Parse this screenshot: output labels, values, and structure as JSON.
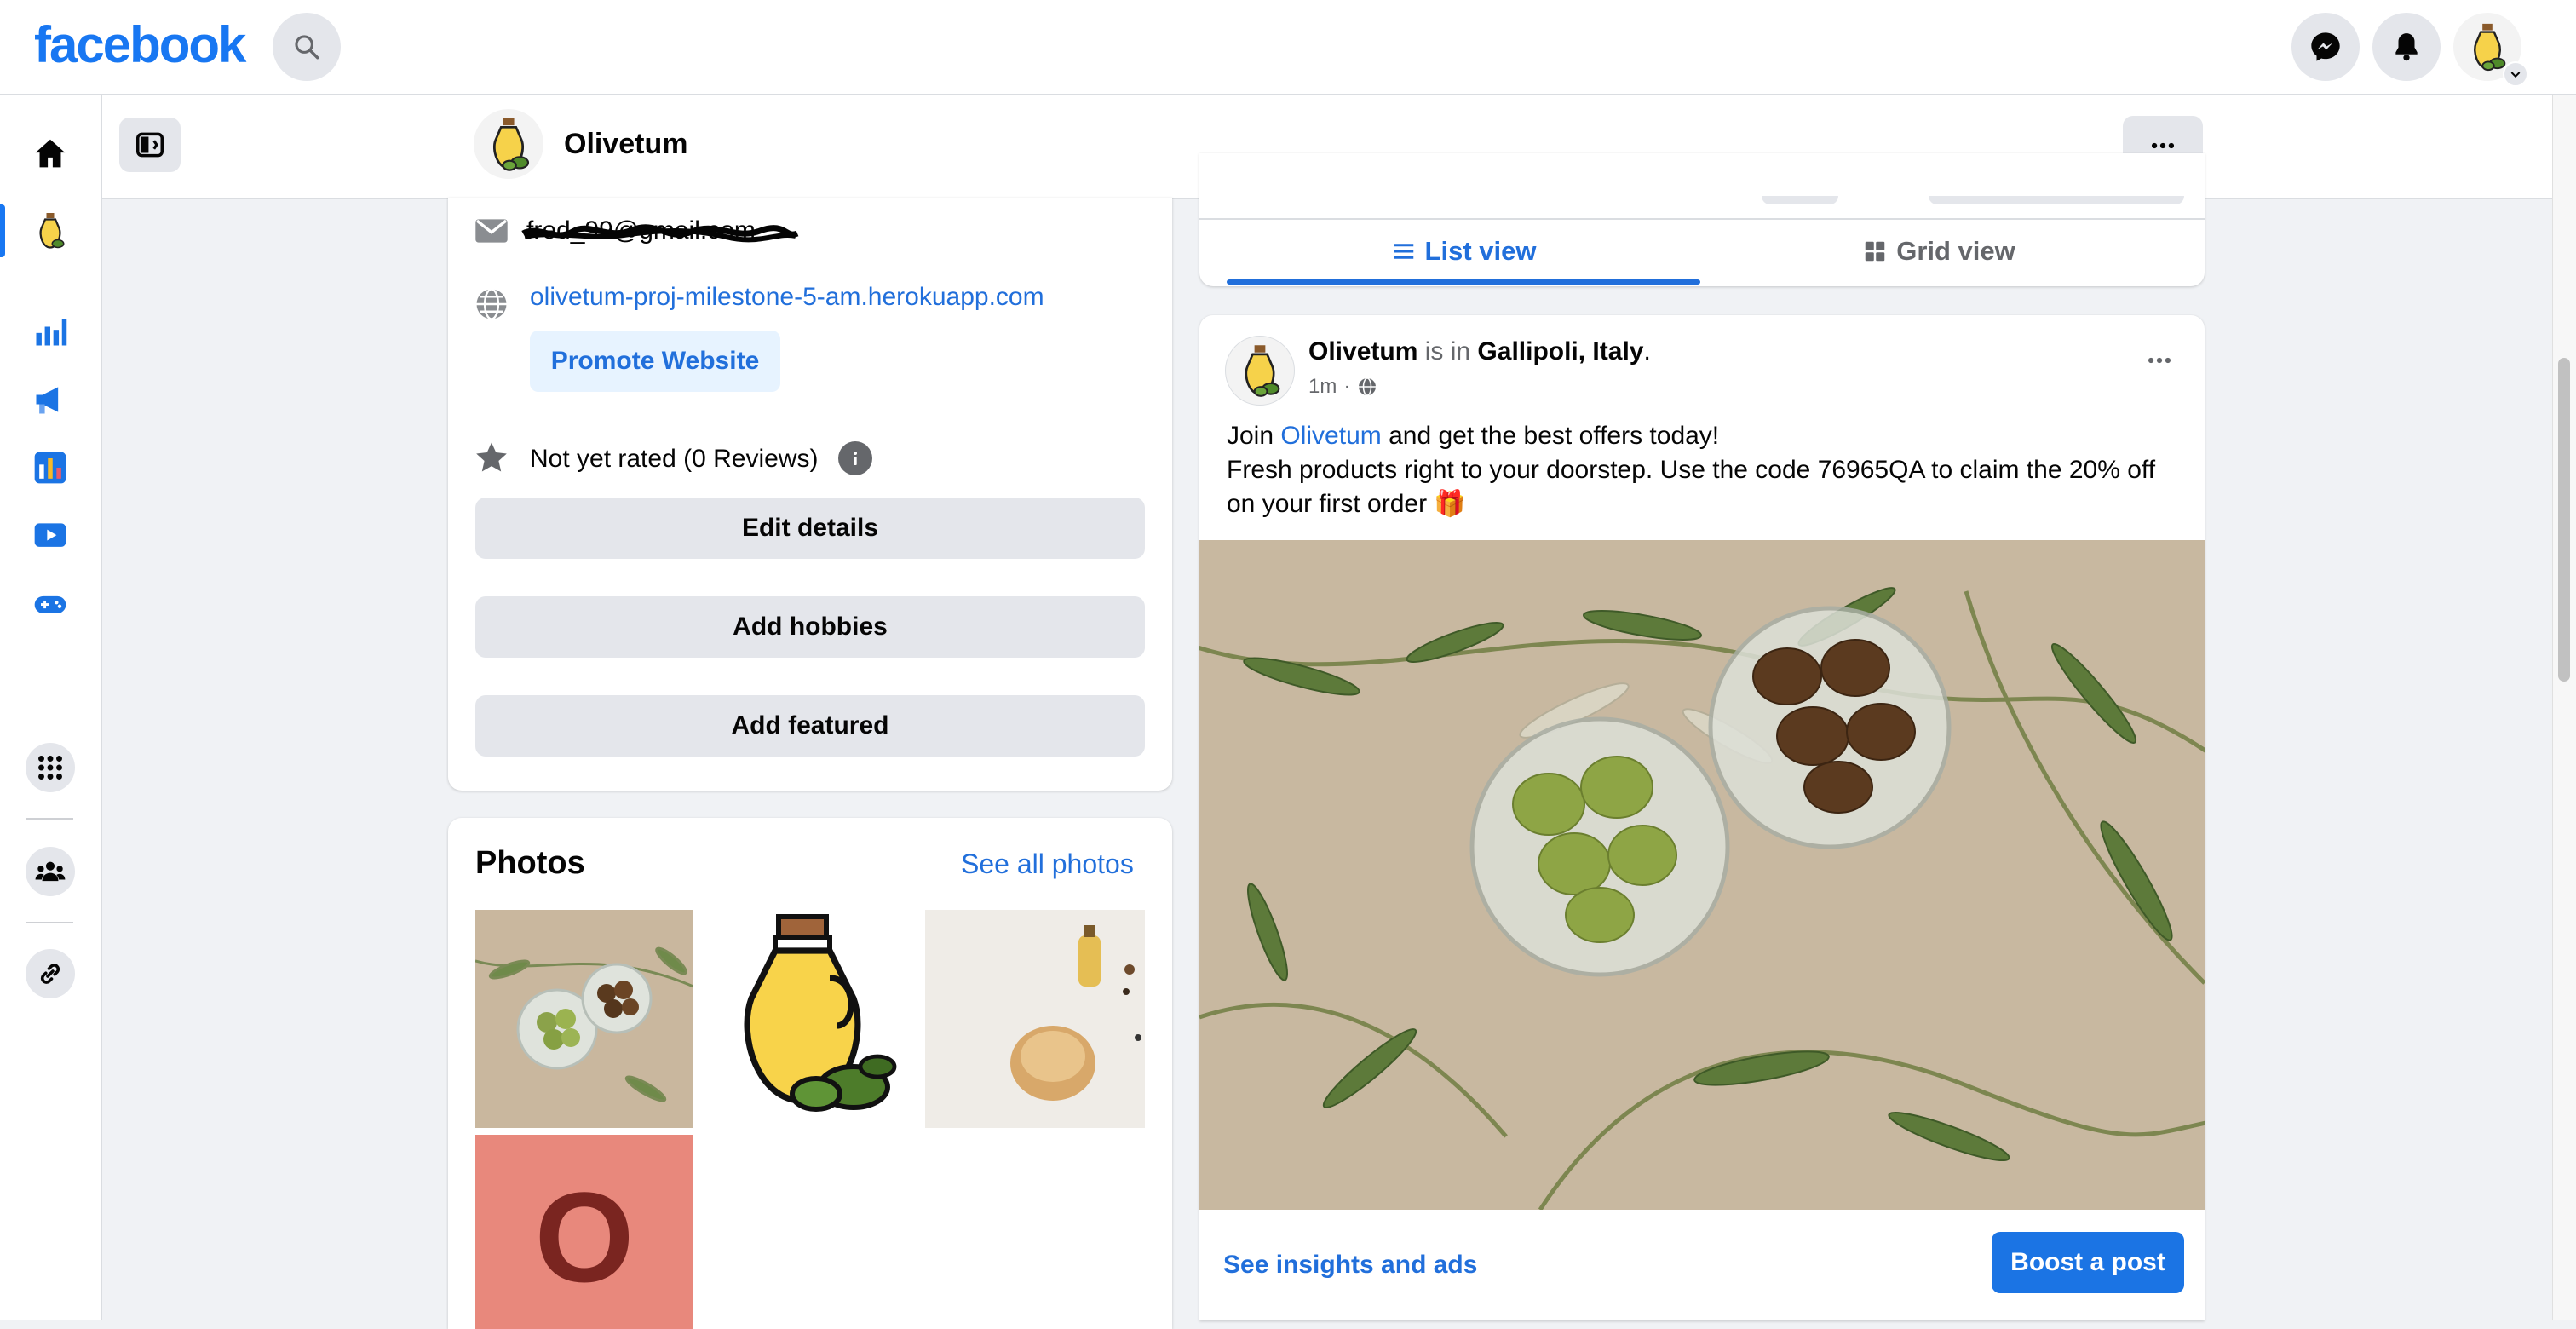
{
  "header": {
    "logo": "facebook"
  },
  "page": {
    "name": "Olivetum"
  },
  "intro": {
    "email": "fred_99@gmail.com",
    "website": "olivetum-proj-milestone-5-am.herokuapp.com",
    "promote_label": "Promote Website",
    "rating": "Not yet rated (0 Reviews)",
    "edit_label": "Edit details",
    "hobbies_label": "Add hobbies",
    "featured_label": "Add featured"
  },
  "photos": {
    "title": "Photos",
    "see_all": "See all photos",
    "letter_tile": "O"
  },
  "view_tabs": {
    "list": "List view",
    "grid": "Grid view"
  },
  "post": {
    "author": "Olivetum",
    "is_in": "is in",
    "location": "Gallipoli, Italy",
    "period": ".",
    "time": "1m",
    "dot": "·",
    "line1_pre": "Join",
    "line1_link": "Olivetum",
    "line1_post": "and get the best offers today!",
    "line2": "Fresh products right to your doorstep. Use the code 76965QA to claim the 20% off on your first order 🎁",
    "insights_label": "See insights and ads",
    "boost_label": "Boost a post"
  },
  "colors": {
    "brand": "#1877f2",
    "link": "#216fdb",
    "background": "#f0f2f5"
  },
  "icons": [
    "search-icon",
    "messenger-icon",
    "bell-icon",
    "home-icon",
    "chart-icon",
    "megaphone-icon",
    "insights-icon",
    "video-icon",
    "gaming-icon",
    "apps-grid-icon",
    "groups-icon",
    "link-icon",
    "sidebar-toggle-icon",
    "more-icon",
    "mail-icon",
    "globe-icon",
    "star-icon",
    "info-icon",
    "list-icon",
    "grid-icon"
  ]
}
